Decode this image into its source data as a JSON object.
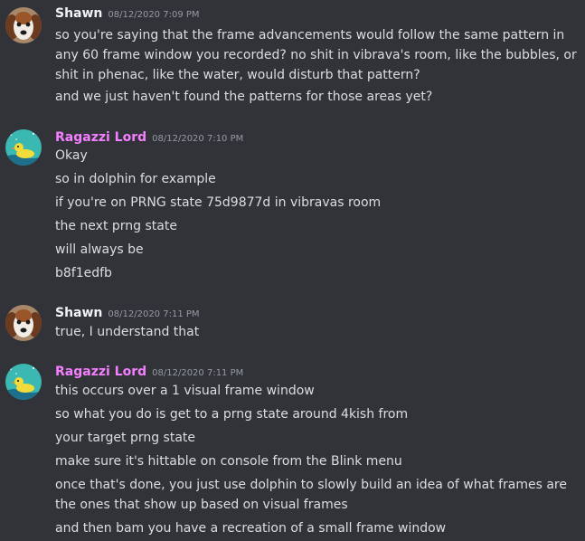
{
  "colors": {
    "background": "#313338",
    "text": "#dbdee1",
    "timestamp": "#949ba4",
    "shawn_name": "#f2f3f5",
    "ragazzi_name": "#f47fff"
  },
  "messages": [
    {
      "author": "Shawn",
      "author_color": "#f2f3f5",
      "avatar_icon": "dog-avatar-icon",
      "timestamp": "08/12/2020 7:09 PM",
      "lines": [
        "so you're saying that the frame advancements would follow the same pattern in any 60 frame window you recorded? no shit in vibrava's room, like the bubbles, or shit in phenac, like the water, would disturb that pattern?",
        "and we just haven't found the patterns for those areas yet?"
      ]
    },
    {
      "author": "Ragazzi Lord",
      "author_color": "#f47fff",
      "avatar_icon": "duck-avatar-icon",
      "timestamp": "08/12/2020 7:10 PM",
      "lines": [
        "Okay",
        "so in dolphin for example",
        "if you're on PRNG state 75d9877d in vibravas room",
        "the next prng state",
        "will always be",
        "b8f1edfb"
      ]
    },
    {
      "author": "Shawn",
      "author_color": "#f2f3f5",
      "avatar_icon": "dog-avatar-icon",
      "timestamp": "08/12/2020 7:11 PM",
      "lines": [
        "true, I understand that"
      ]
    },
    {
      "author": "Ragazzi Lord",
      "author_color": "#f47fff",
      "avatar_icon": "duck-avatar-icon",
      "timestamp": "08/12/2020 7:11 PM",
      "lines": [
        "this occurs over a 1 visual frame window",
        "so what you do is get to a prng state around 4kish from",
        "your target prng state",
        "make sure it's hittable on console from the Blink menu",
        "once that's done, you just use dolphin to slowly build an idea of what frames are the ones that show up based on visual frames",
        "and then bam you have a recreation of a small frame window"
      ]
    }
  ]
}
